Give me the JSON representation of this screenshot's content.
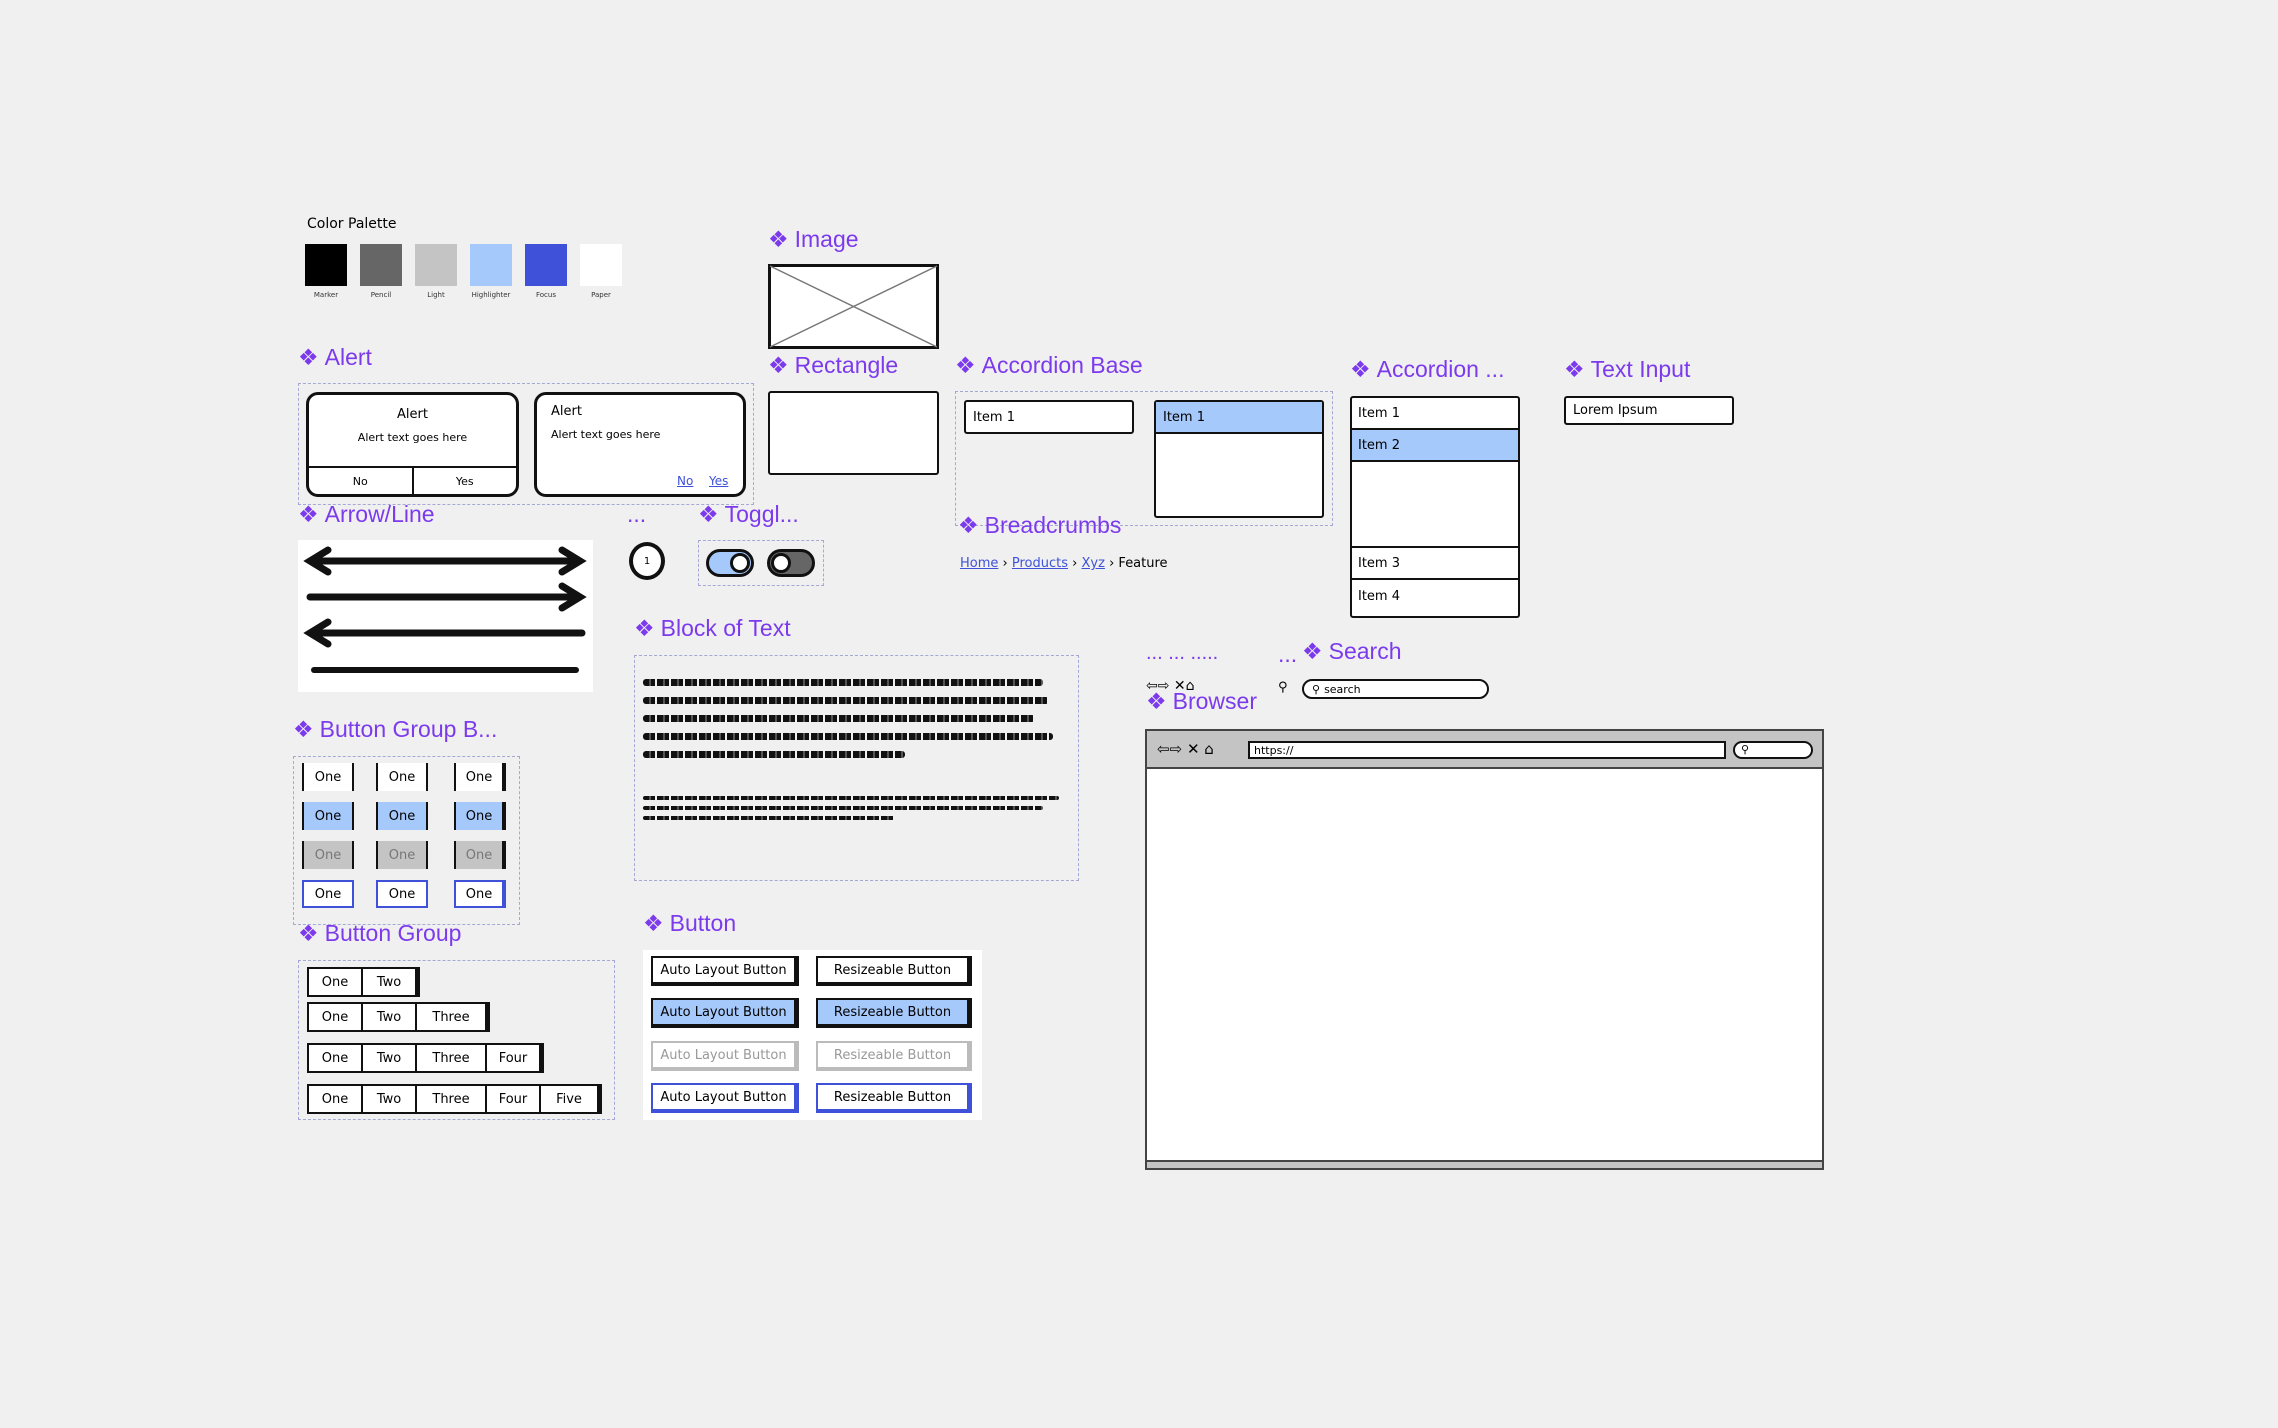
{
  "palette": {
    "title": "Color Palette",
    "swatches": [
      {
        "name": "Marker",
        "color": "#000000"
      },
      {
        "name": "Pencil",
        "color": "#666666"
      },
      {
        "name": "Light",
        "color": "#c4c4c4"
      },
      {
        "name": "Highlighter",
        "color": "#a6c9fb"
      },
      {
        "name": "Focus",
        "color": "#3f51d9"
      },
      {
        "name": "Paper",
        "color": "#ffffff"
      }
    ]
  },
  "sections": {
    "image": "Image",
    "alert": "Alert",
    "rectangle": "Rectangle",
    "accordion_base": "Accordion Base",
    "accordion": "Accordion ...",
    "text_input": "Text Input",
    "arrow_line": "Arrow/Line",
    "dots": "...",
    "toggle": "Toggl...",
    "breadcrumbs": "Breadcrumbs",
    "block_of_text": "Block of Text",
    "browser_dots": "... ... .....",
    "search_dots": "...",
    "search": "Search",
    "browser": "Browser",
    "button_group_b": "Button Group B...",
    "button_group": "Button Group",
    "button": "Button"
  },
  "alert": {
    "a": {
      "title": "Alert",
      "text": "Alert text goes here",
      "no": "No",
      "yes": "Yes"
    },
    "b": {
      "title": "Alert",
      "text": "Alert text goes here",
      "no": "No",
      "yes": "Yes"
    }
  },
  "accordion_base": {
    "item1": "Item 1",
    "item1_open": "Item 1"
  },
  "accordion": {
    "items": [
      "Item 1",
      "Item 2",
      "Item 3",
      "Item 4"
    ]
  },
  "text_input": {
    "value": "Lorem Ipsum"
  },
  "badge": {
    "value": "1"
  },
  "breadcrumbs": {
    "items": [
      "Home",
      "Products",
      "Xyz"
    ],
    "current": "Feature"
  },
  "search": {
    "placeholder": "search"
  },
  "browser": {
    "url": "https://"
  },
  "button_group_b": {
    "label": "One"
  },
  "button_group": {
    "rows": [
      [
        "One",
        "Two"
      ],
      [
        "One",
        "Two",
        "Three"
      ],
      [
        "One",
        "Two",
        "Three",
        "Four"
      ],
      [
        "One",
        "Two",
        "Three",
        "Four",
        "Five"
      ]
    ]
  },
  "button": {
    "auto": "Auto Layout Button",
    "resize": "Resizeable Button"
  }
}
